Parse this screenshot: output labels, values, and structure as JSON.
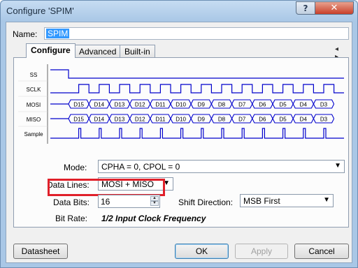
{
  "window": {
    "title": "Configure 'SPIM'",
    "help_glyph": "?",
    "close_glyph": "✕"
  },
  "name": {
    "label": "Name:",
    "value": "SPIM"
  },
  "tabs": [
    {
      "label": "Configure",
      "selected": true
    },
    {
      "label": "Advanced",
      "selected": false
    },
    {
      "label": "Built-in",
      "selected": false
    }
  ],
  "tab_scroll": "◂ ▸",
  "waveform": {
    "signals": [
      "SS",
      "SCLK",
      "MOSI",
      "MISO",
      "Sample"
    ],
    "mosi_bits": [
      "D15",
      "D14",
      "D13",
      "D12",
      "D11",
      "D10",
      "D9",
      "D8",
      "D7",
      "D6",
      "D5",
      "D4",
      "D3"
    ],
    "miso_bits": [
      "D15",
      "D14",
      "D13",
      "D12",
      "D11",
      "D10",
      "D9",
      "D8",
      "D7",
      "D6",
      "D5",
      "D4",
      "D3"
    ],
    "line_color": "#0000cc"
  },
  "form": {
    "mode_label": "Mode:",
    "mode_value": "CPHA = 0, CPOL = 0",
    "data_lines_label": "Data Lines:",
    "data_lines_value": "MOSI + MISO",
    "data_bits_label": "Data Bits:",
    "data_bits_value": "16",
    "shift_direction_label": "Shift Direction:",
    "shift_direction_value": "MSB First",
    "bit_rate_label": "Bit Rate:",
    "bit_rate_value": "1/2 Input Clock Frequency"
  },
  "buttons": {
    "datasheet": "Datasheet",
    "ok": "OK",
    "apply": "Apply",
    "cancel": "Cancel"
  },
  "colors": {
    "highlight": "#e0202a",
    "selection": "#3399ff"
  }
}
